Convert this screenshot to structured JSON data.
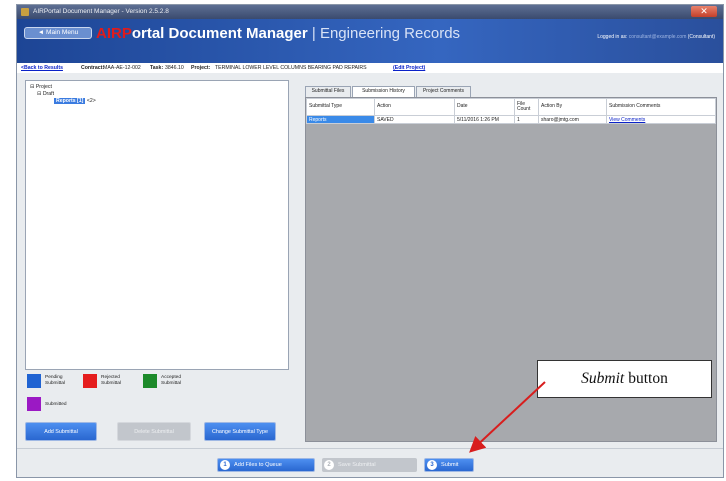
{
  "window": {
    "title": "AIRPortal Document Manager - Version 2.5.2.8",
    "close_glyph": "✕"
  },
  "header": {
    "main_menu_label": "◄ Main Menu",
    "brand_prefix": "AIRP",
    "brand_rest": "ortal Document Manager",
    "brand_separator": " | ",
    "brand_sub": "Engineering Records",
    "logged_in_label": "Logged in as:",
    "logged_in_user": "consultant@example.com",
    "role": "(Consultant)"
  },
  "infobar": {
    "back_link": "<Back to Results",
    "contract_label": "Contract:",
    "contract_value": "MAA-AE-12-002",
    "task_label": "Task:",
    "task_value": "3846.10",
    "project_label": "Project:",
    "project_value": "TERMINAL LOWER LEVEL COLUMNS BEARING PAD REPAIRS",
    "edit_project_link": "(Edit Project)"
  },
  "tree": {
    "root": "Project",
    "draft": "Draft",
    "selected_item": "Reports [1]",
    "expand_glyph": "⊟",
    "badge": "<2>"
  },
  "legend": {
    "pending": {
      "label": "Pending Submittal",
      "color": "#1f63d2"
    },
    "rejected": {
      "label": "Rejected Submittal",
      "color": "#e51d1d"
    },
    "accepted": {
      "label": "Accepted Submittal",
      "color": "#1c8a2a"
    },
    "submitted": {
      "label": "Submitted",
      "color": "#9b19c4"
    }
  },
  "left_buttons": {
    "add_submittal": "Add Submittal",
    "delete_submittal": "Delete Submittal",
    "change_type": "Change Submittal Type"
  },
  "tabs": [
    {
      "label": "Submittal Files",
      "active": false
    },
    {
      "label": "Submission History",
      "active": true
    },
    {
      "label": "Project Comments",
      "active": false
    }
  ],
  "history_table": {
    "headers": [
      "Submittal Type",
      "Action",
      "Date",
      "File Count",
      "Action By",
      "Submission Comments"
    ],
    "rows": [
      [
        "Reports",
        "SAVED",
        "5/11/2016 1:26 PM",
        "1",
        "sharo@jmtg.com",
        "View Comments"
      ]
    ]
  },
  "bottom_buttons": {
    "add_files": {
      "num": "1",
      "label": "Add Files to Queue"
    },
    "save_submittal": {
      "num": "2",
      "label": "Save Submittal"
    },
    "submit": {
      "num": "3",
      "label": "Submit"
    }
  },
  "callout": {
    "italic": "Submit",
    "rest": "button",
    "arrow_color": "#d81e1e"
  }
}
